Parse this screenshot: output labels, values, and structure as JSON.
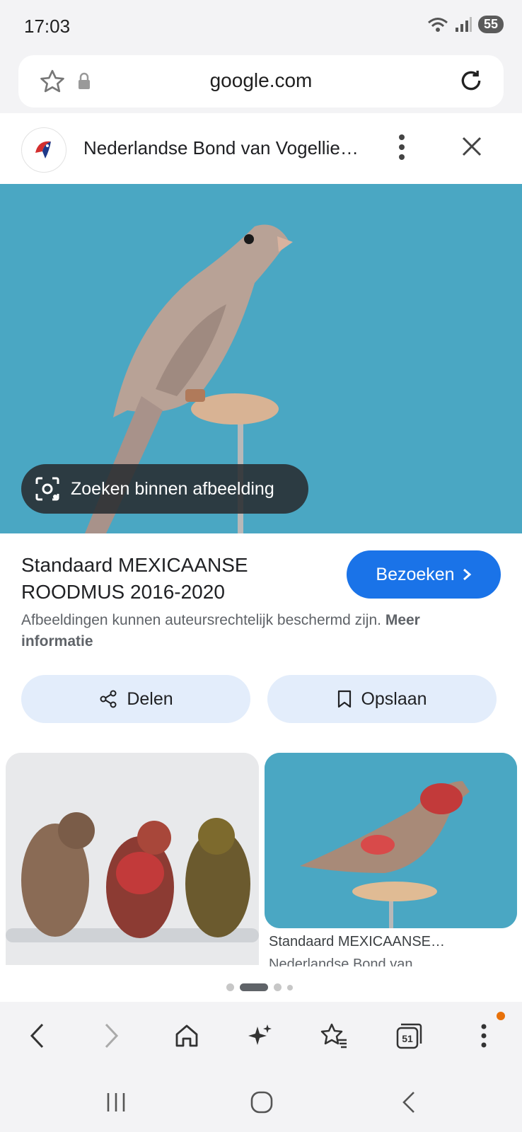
{
  "status_bar": {
    "time": "17:03",
    "battery": "55"
  },
  "address_bar": {
    "url": "google.com"
  },
  "source": {
    "title": "Nederlandse Bond van Vogellie…"
  },
  "image": {
    "lens_label": "Zoeken binnen afbeelding"
  },
  "result": {
    "title": "Standaard MEXICAANSE ROODMUS 2016-2020",
    "visit_label": "Bezoeken",
    "copyright_text": "Afbeeldingen kunnen auteursrechtelijk beschermd zijn.",
    "copyright_link": "Meer informatie"
  },
  "actions": {
    "share_label": "Delen",
    "save_label": "Opslaan"
  },
  "related": [
    {
      "title": "",
      "source": ""
    },
    {
      "title": "Standaard MEXICAANSE…",
      "source": "Nederlandse Bond van"
    }
  ],
  "toolbar": {
    "tabs_count": "51"
  },
  "colors": {
    "accent": "#1a73e8",
    "chip": "#e3edfb",
    "sky": "#4aa7c3"
  }
}
